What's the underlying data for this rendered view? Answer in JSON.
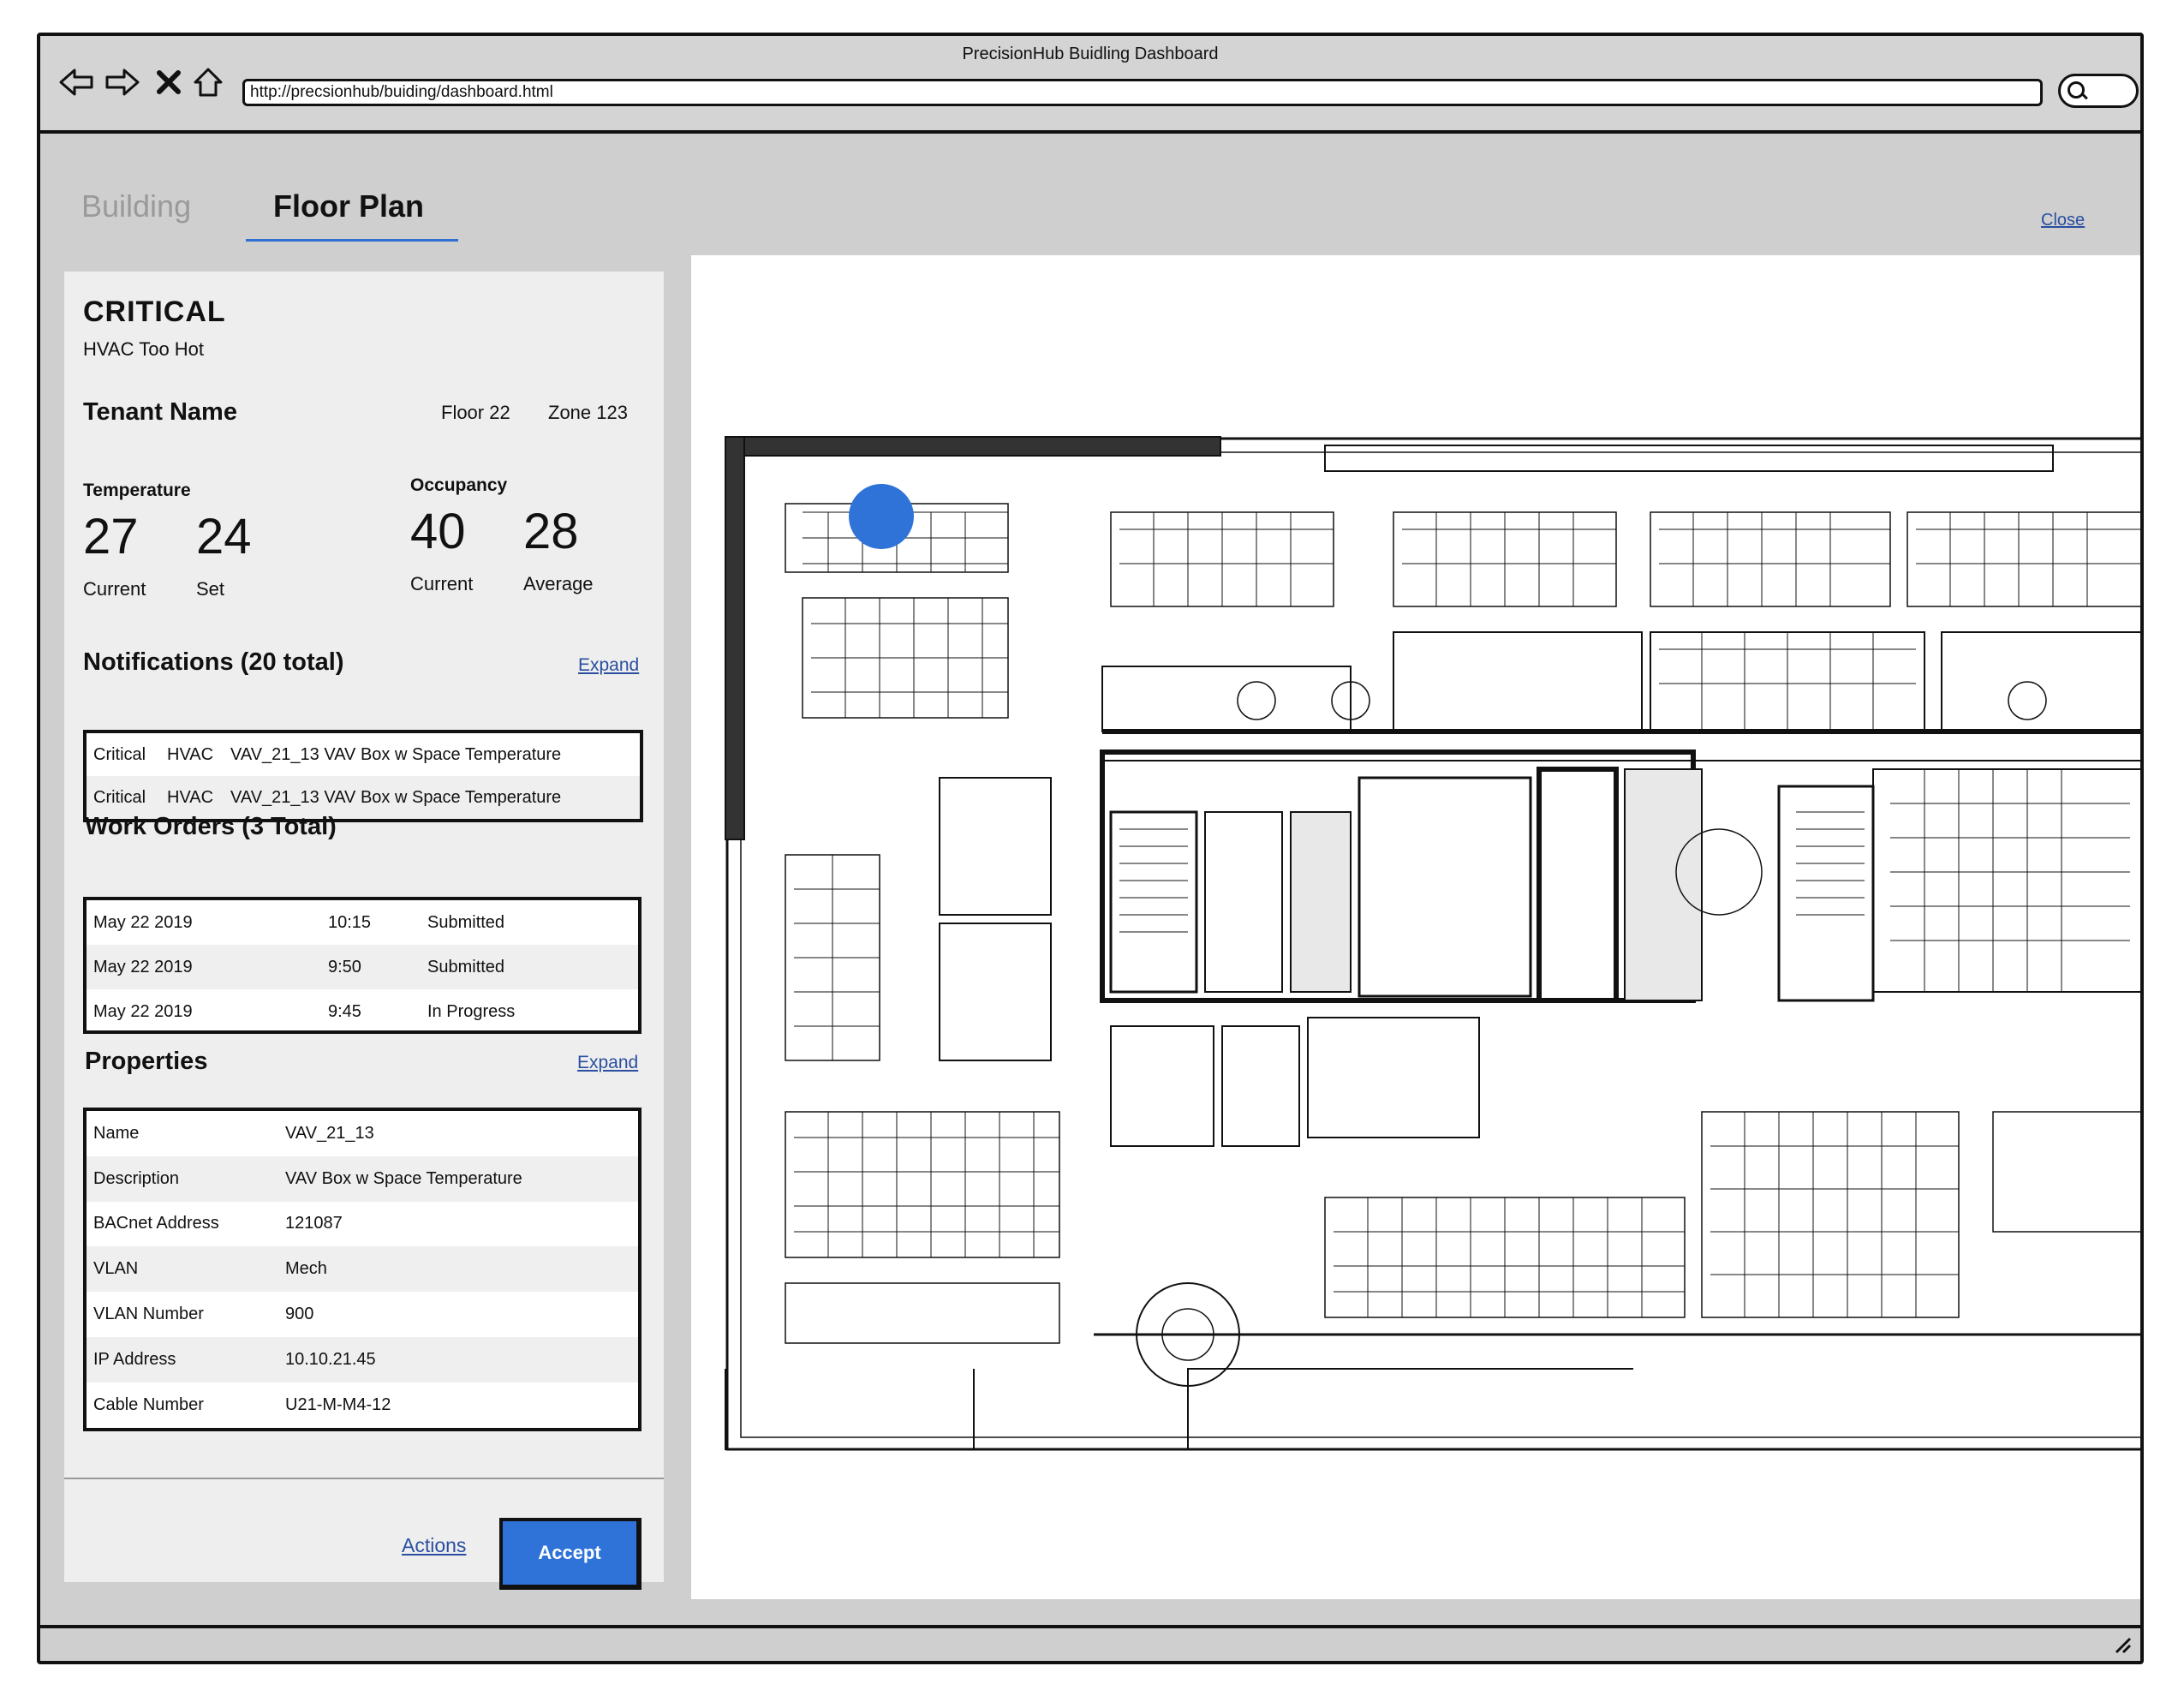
{
  "window": {
    "title": "PrecisionHub Buidling Dashboard",
    "url": "http://precsionhub/buiding/dashboard.html"
  },
  "tabs": [
    {
      "label": "Building",
      "active": false
    },
    {
      "label": "Floor Plan",
      "active": true
    }
  ],
  "close_label": "Close",
  "alert": {
    "severity": "CRITICAL",
    "message": "HVAC Too Hot",
    "tenant": "Tenant Name",
    "floor": "Floor 22",
    "zone": "Zone 123"
  },
  "temperature": {
    "label": "Temperature",
    "current": "27",
    "set": "24",
    "current_caption": "Current",
    "set_caption": "Set"
  },
  "occupancy": {
    "label": "Occupancy",
    "current": "40",
    "average": "28",
    "current_caption": "Current",
    "average_caption": "Average"
  },
  "notifications": {
    "title": "Notifications (20 total)",
    "expand_label": "Expand",
    "items": [
      {
        "severity": "Critical",
        "system": "HVAC",
        "text": "VAV_21_13 VAV Box w Space Temperature"
      },
      {
        "severity": "Critical",
        "system": "HVAC",
        "text": "VAV_21_13 VAV Box w Space Temperature"
      }
    ]
  },
  "work_orders": {
    "title": "Work Orders (3 Total)",
    "items": [
      {
        "date": "May 22 2019",
        "time": "10:15",
        "status": "Submitted"
      },
      {
        "date": "May 22 2019",
        "time": "9:50",
        "status": "Submitted"
      },
      {
        "date": "May 22 2019",
        "time": "9:45",
        "status": "In Progress"
      }
    ]
  },
  "properties": {
    "title": "Properties",
    "expand_label": "Expand",
    "items": [
      {
        "key": "Name",
        "value": "VAV_21_13"
      },
      {
        "key": "Description",
        "value": "VAV Box w Space Temperature"
      },
      {
        "key": "BACnet Address",
        "value": "121087"
      },
      {
        "key": "VLAN",
        "value": "Mech"
      },
      {
        "key": "VLAN Number",
        "value": "900"
      },
      {
        "key": "IP Address",
        "value": "10.10.21.45"
      },
      {
        "key": "Cable Number",
        "value": "U21-M-M4-12"
      }
    ]
  },
  "actions_label": "Actions",
  "accept_label": "Accept",
  "colors": {
    "accent": "#2f73d9",
    "marker": "#2f73d9",
    "link": "#2a4fa0"
  },
  "icons": [
    "back-arrow-icon",
    "forward-arrow-icon",
    "stop-icon",
    "home-icon",
    "search-icon",
    "resize-grip-icon"
  ]
}
